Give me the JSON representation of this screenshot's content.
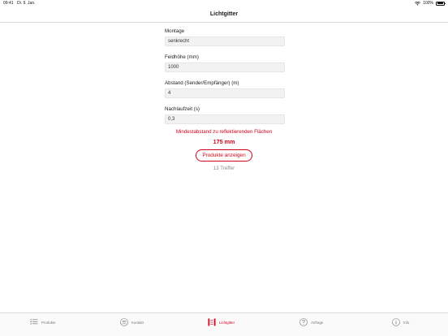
{
  "status_bar": {
    "time": "09:41",
    "date": "Di. 9. Jan.",
    "battery": "100%"
  },
  "nav": {
    "title": "Lichtgitter"
  },
  "form": {
    "fields": [
      {
        "label": "Montage",
        "value": "senkrecht"
      },
      {
        "label": "Feldhöhe (mm)",
        "value": "1000"
      },
      {
        "label": "Abstand (Sender/Empfänger) (m)",
        "value": "4"
      },
      {
        "label": "Nachlaufzeit (s)",
        "value": "0,3"
      }
    ]
  },
  "result": {
    "min_distance_label": "Mindestabstand zu reflektierenden Flächen",
    "min_distance_value": "175 mm",
    "products_button": "Produkte anzeigen",
    "hits": "13 Treffer"
  },
  "tabs": [
    {
      "label": "Produkte",
      "icon": "list-icon",
      "active": false
    },
    {
      "label": "Kontakt",
      "icon": "people-icon",
      "active": false
    },
    {
      "label": "Lichtgitter",
      "icon": "light-grid-icon",
      "active": true
    },
    {
      "label": "Anfrage",
      "icon": "question-icon",
      "active": false
    },
    {
      "label": "Info",
      "icon": "info-icon",
      "active": false
    }
  ],
  "colors": {
    "accent": "#d0021b",
    "field_background": "#f2f2f2",
    "inactive_tab": "#777777"
  }
}
